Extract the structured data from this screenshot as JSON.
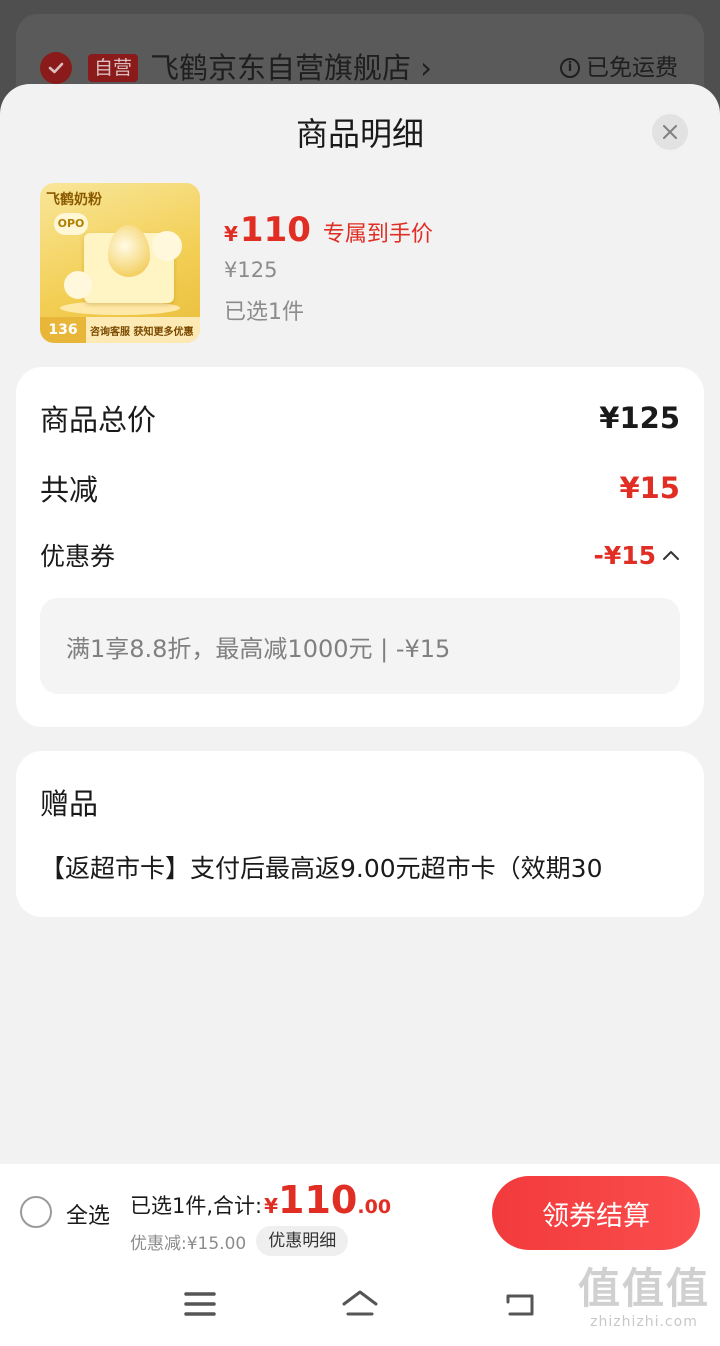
{
  "background": {
    "store_tag": "自营",
    "store_name": "飞鹤京东自营旗舰店 ›",
    "freight": "已免运费"
  },
  "sheet": {
    "title": "商品明细",
    "close_icon": "close-icon"
  },
  "product": {
    "image_brand": "飞鹤奶粉",
    "image_badge": "OPO",
    "image_count": "136",
    "image_banner": "咨询客服 获知更多优惠",
    "price_symbol": "¥",
    "price": "110",
    "price_label": "专属到手价",
    "original_price": "¥125",
    "selected": "已选1件"
  },
  "summary": {
    "total_label": "商品总价",
    "total_value": "¥125",
    "discount_label": "共减",
    "discount_value": "¥15",
    "coupon_label": "优惠券",
    "coupon_value": "-¥15",
    "coupon_detail": "满1享8.8折，最高减1000元 | -¥15"
  },
  "gift": {
    "title": "赠品",
    "text": "【返超市卡】支付后最高返9.00元超市卡（效期30"
  },
  "bottom_bar": {
    "select_all": "全选",
    "sum_prefix": "已选1件,合计:",
    "sum_yen": "¥",
    "sum_int": "110",
    "sum_dec": ".00",
    "discount_text": "优惠减:¥15.00",
    "discount_detail": "优惠明细",
    "checkout": "领券结算"
  },
  "watermark": {
    "big": "值值值",
    "small": "zhizhizhi.com"
  },
  "colors": {
    "accent_red": "#e02e24",
    "checkout_gradient_start": "#f23a3c",
    "sheet_bg": "#f2f2f2"
  }
}
